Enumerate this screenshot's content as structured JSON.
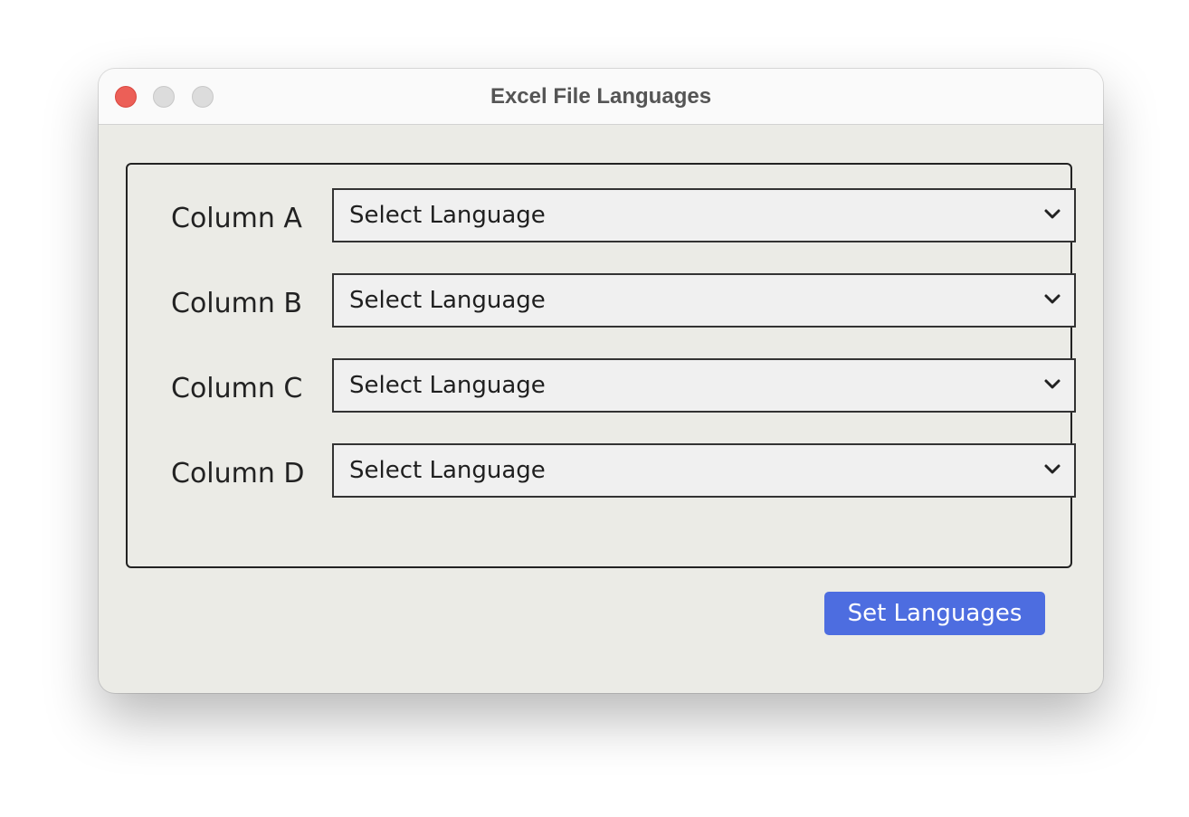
{
  "window": {
    "title": "Excel File Languages"
  },
  "rows": [
    {
      "label": "Column A",
      "selected": "Select Language"
    },
    {
      "label": "Column B",
      "selected": "Select Language"
    },
    {
      "label": "Column C",
      "selected": "Select Language"
    },
    {
      "label": "Column D",
      "selected": "Select Language"
    }
  ],
  "actions": {
    "set_label": "Set Languages"
  },
  "colors": {
    "accent": "#4d6de0",
    "close": "#ec5f57",
    "window_bg": "#ebebe6"
  }
}
